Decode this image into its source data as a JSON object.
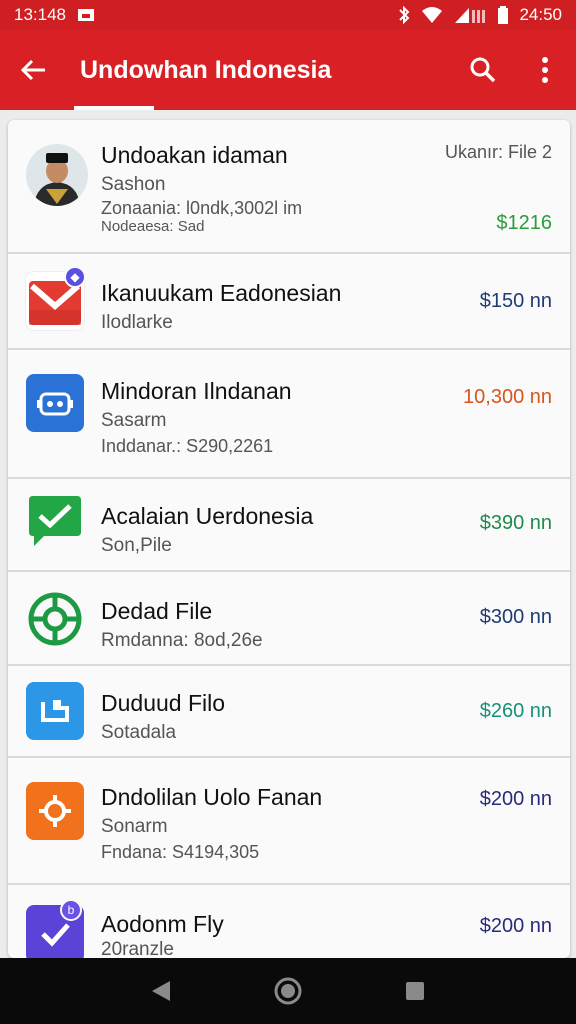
{
  "status_bar": {
    "time": "13:148",
    "clock": "24:50"
  },
  "toolbar": {
    "title": "Undowhan Indonesia"
  },
  "list": [
    {
      "name": "Undoakan idaman",
      "sub": "Sashon",
      "sub2": "Zonaania: l0ndk,3002l im",
      "sub3": "Nodeaesa: Sad",
      "meta": "Ukanır: File 2",
      "price": "$1216",
      "price_color": "#2a9d3a",
      "icon": "profile-photo-icon"
    },
    {
      "name": "Ikanuukam Eadonesian",
      "sub": "Ilodlarke",
      "price": "$150 nn",
      "price_color": "#1f3b73",
      "icon": "gmail-icon"
    },
    {
      "name": "Mindoran Ilndanan",
      "sub": "Sasarm",
      "sub2": "Inddanar.: S290,2261",
      "price": "10,300 nn",
      "price_color": "#d9541c",
      "icon": "robot-icon"
    },
    {
      "name": "Acalaian Uerdonesia",
      "sub": "Son,Pile",
      "price": "$390 nn",
      "price_color": "#1f8a4c",
      "icon": "chat-check-icon"
    },
    {
      "name": "Dedad File",
      "sub": "Rmdanna: 8od,26e",
      "price": "$300 nn",
      "price_color": "#1f3b73",
      "icon": "gear-icon"
    },
    {
      "name": "Duduud Filo",
      "sub": "Sotadala",
      "price": "$260 nn",
      "price_color": "#1a8f7a",
      "icon": "folder-icon"
    },
    {
      "name": "Dndolilan Uolo Fanan",
      "sub": "Sonarm",
      "sub2": "Fndana: S4194,305",
      "price": "$200 nn",
      "price_color": "#2a2a7a",
      "icon": "location-icon"
    },
    {
      "name": "Aodonm Fly",
      "sub": "20ranzle",
      "price": "$200 nn",
      "price_color": "#2a2a7a",
      "icon": "task-check-icon"
    }
  ]
}
